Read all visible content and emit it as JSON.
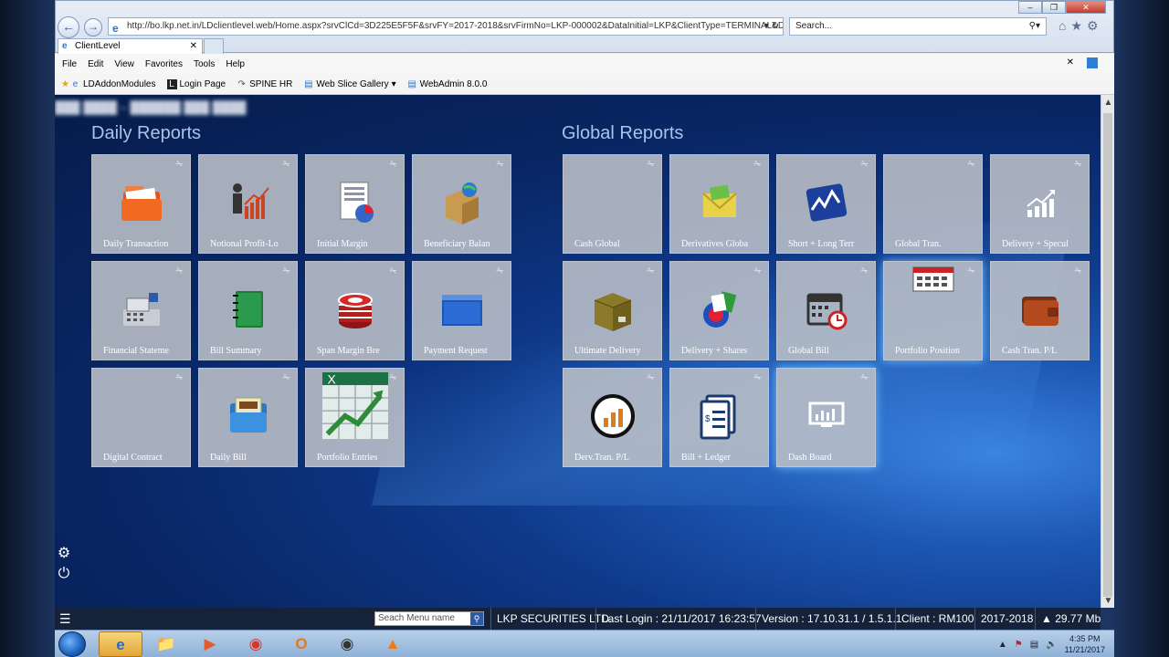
{
  "browser": {
    "address_url": "http://bo.lkp.net.in/LDclientlevel.web/Home.aspx?srvClCd=3D225E5F5F&srvFY=2017-2018&srvFirmNo=LKP-000002&DataInitial=LKP&ClientType=TERMINAL&D",
    "search_placeholder": "Search...",
    "tab_title": "ClientLevel",
    "menu": [
      "File",
      "Edit",
      "View",
      "Favorites",
      "Tools",
      "Help"
    ],
    "favorites": [
      "LDAddonModules",
      "Login Page",
      "SPINE HR",
      "Web Slice Gallery",
      "WebAdmin 8.0.0"
    ]
  },
  "app": {
    "daily_title": "Daily Reports",
    "global_title": "Global Reports",
    "daily_tiles": [
      {
        "label": "Daily Transaction",
        "icon": "folder-icon"
      },
      {
        "label": "Notional Profit-Lo",
        "icon": "profit-chart-icon"
      },
      {
        "label": "Initial Margin",
        "icon": "report-pie-icon"
      },
      {
        "label": "Beneficiary Balan",
        "icon": "box-globe-icon"
      },
      {
        "label": "Financial Stateme",
        "icon": "cash-register-icon"
      },
      {
        "label": "Bill Summary",
        "icon": "notebook-icon"
      },
      {
        "label": "Span Margin Bre",
        "icon": "poker-chips-icon"
      },
      {
        "label": "Payment Request",
        "icon": "windows-icon"
      },
      {
        "label": "Digital Contract",
        "icon": ""
      },
      {
        "label": "Daily Bill",
        "icon": "file-folder-icon"
      },
      {
        "label": "Portfolio Entries",
        "icon": "excel-chart-icon"
      }
    ],
    "global_tiles": [
      {
        "label": "Cash Global",
        "icon": ""
      },
      {
        "label": "Derivatives Globa",
        "icon": "envelope-icon"
      },
      {
        "label": "Short + Long Terr",
        "icon": "stock-chart-icon"
      },
      {
        "label": "Global Tran.",
        "icon": ""
      },
      {
        "label": "Delivery + Specul",
        "icon": "growth-chart-icon"
      },
      {
        "label": "Ultimate Delivery",
        "icon": "package-icon"
      },
      {
        "label": "Delivery + Shares",
        "icon": "shares-icon"
      },
      {
        "label": "Global Bill",
        "icon": "calendar-clock-icon"
      },
      {
        "label": "Portfolio Position",
        "icon": "calendar-grid-icon"
      },
      {
        "label": "Cash Tran. P/L",
        "icon": "wallet-icon"
      },
      {
        "label": "Derv.Tran.  P/L",
        "icon": "bar-circle-icon"
      },
      {
        "label": "Bill + Ledger",
        "icon": "invoice-icon"
      },
      {
        "label": "Dash Board",
        "icon": "dashboard-icon"
      }
    ]
  },
  "status": {
    "search_menu_placeholder": "Seach Menu name",
    "company": "LKP SECURITIES LTD.",
    "last_login": "Last Login : 21/11/2017 16:23:57",
    "version": "Version : 17.10.31.1 / 1.5.1.1",
    "client": "Client : RM100",
    "fy": "2017-2018",
    "memory": "29.77 Mb"
  },
  "taskbar": {
    "time": "4:35 PM",
    "date": "11/21/2017"
  }
}
